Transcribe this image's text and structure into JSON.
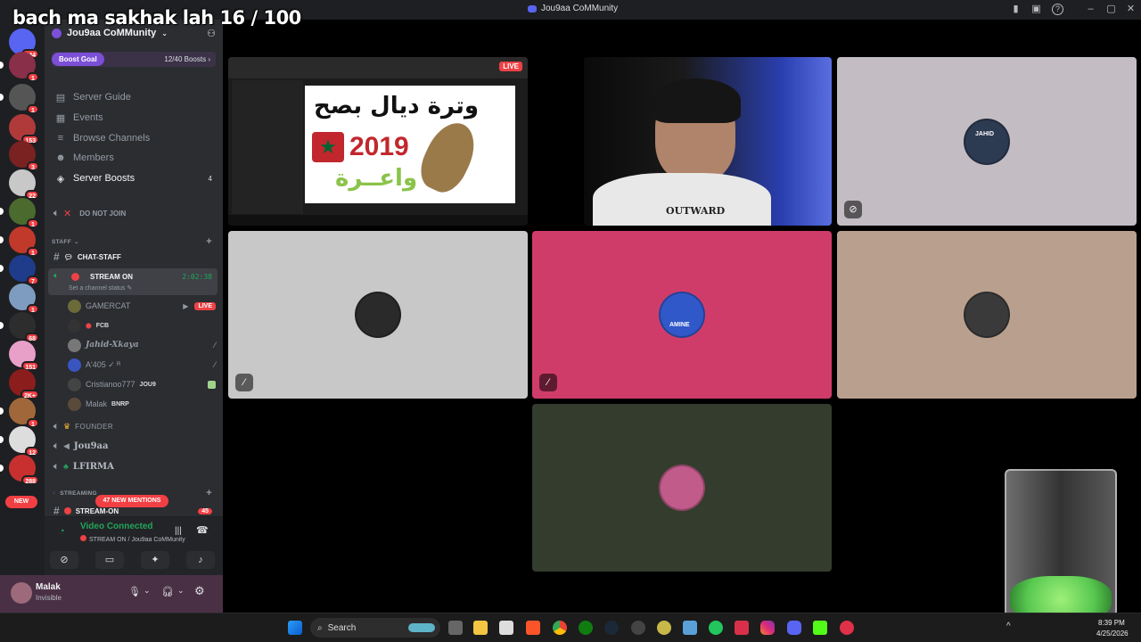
{
  "overlay": {
    "title": "bach ma sakhak lah 16 / 100"
  },
  "window": {
    "title": "Jou9aa CoMMunity"
  },
  "rail": {
    "badges": [
      "344",
      "1",
      "1",
      "153",
      "3",
      "22",
      "1",
      "1",
      "7",
      "1",
      "68",
      "151",
      "2K+",
      "1",
      "12",
      "288"
    ],
    "new_label": "NEW"
  },
  "server": {
    "name": "Jou9aa CoMMunity",
    "boost_goal_label": "Boost Goal",
    "boost_count": "12/40 Boosts"
  },
  "nav": [
    {
      "label": "Server Guide",
      "icon": "guide-icon"
    },
    {
      "label": "Events",
      "icon": "calendar-icon"
    },
    {
      "label": "Browse Channels",
      "icon": "browse-icon"
    },
    {
      "label": "Members",
      "icon": "members-icon"
    },
    {
      "label": "Server Boosts",
      "icon": "boost-icon",
      "count": "4"
    }
  ],
  "channels": {
    "do_not_join": "DO NOT JOIN",
    "staff_category": "STAFF",
    "chat_staff": "CHAT-STAFF",
    "stream_on": "STREAM ON",
    "stream_timer": "2:02:38",
    "set_status": "Set a channel status",
    "founder": "FOUNDER",
    "jou9aa": "Jou9aa",
    "lfirma": "LFIRMA",
    "streaming_category": "STREAMING",
    "stream_on2": "STREAM-ON",
    "stream_on2_count": "45",
    "mentions_pill": "47 NEW MENTIONS"
  },
  "voice_users": [
    {
      "name": "GAMERCAT",
      "tag": "",
      "live": "LIVE"
    },
    {
      "name": "",
      "tag": "FCB",
      "live": ""
    },
    {
      "name": "Jahid-Xkaya",
      "tag": "",
      "live": ""
    },
    {
      "name": "A'405 ✓ ᴿ",
      "tag": "",
      "live": ""
    },
    {
      "name": "Cristianoo777",
      "tag": "JOU9",
      "live": ""
    },
    {
      "name": "Malak",
      "tag": "BNRP",
      "live": ""
    }
  ],
  "voice_panel": {
    "status": "Video Connected",
    "location": "STREAM ON / Jou9aa CoMMunity"
  },
  "user": {
    "name": "Malak",
    "status": "Invisible"
  },
  "stream": {
    "live_badge": "LIVE",
    "thumb_arabic_title": "وترة ديال بصح",
    "thumb_year": "2019",
    "thumb_arabic_sub": "واعــرة",
    "shirt_text": "OUTWARD"
  },
  "tiles": [
    {
      "color": "#c3bcc3"
    },
    {
      "color": "#c8c8c8"
    },
    {
      "color": "#d03c6a"
    },
    {
      "color": "#b9a08e"
    },
    {
      "color": "#343d2d"
    }
  ],
  "avatar_labels": [
    "JAHID",
    "AMINE"
  ],
  "taskbar": {
    "search": "Search",
    "time": "8:39 PM",
    "date": "4/25/2026"
  }
}
